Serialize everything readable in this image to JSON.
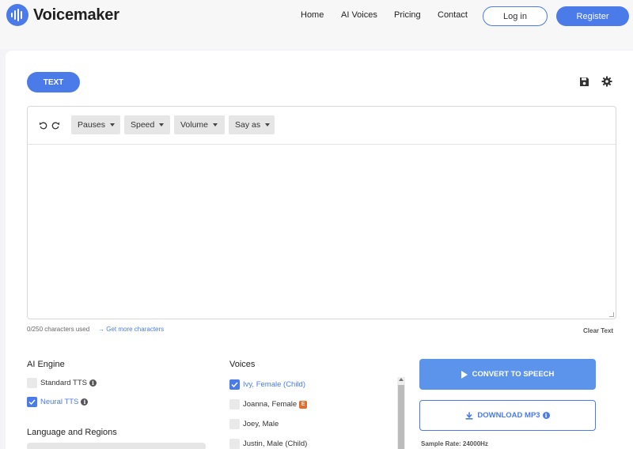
{
  "header": {
    "logo_text": "Voicemaker",
    "nav": [
      "Home",
      "AI Voices",
      "Pricing",
      "Contact"
    ],
    "login": "Log in",
    "register": "Register"
  },
  "editor": {
    "tab": "TEXT",
    "dropdowns": [
      "Pauses",
      "Speed",
      "Volume",
      "Say as"
    ],
    "char_count": "0/250 characters used",
    "more_chars": "Get more characters",
    "clear": "Clear Text"
  },
  "engine": {
    "title": "AI Engine",
    "options": [
      {
        "label": "Standard TTS",
        "checked": false
      },
      {
        "label": "Neural TTS",
        "checked": true
      }
    ]
  },
  "language": {
    "title": "Language and Regions"
  },
  "voices": {
    "title": "Voices",
    "items": [
      {
        "label": "Ivy, Female (Child)",
        "checked": true
      },
      {
        "label": "Joanna, Female",
        "checked": false,
        "badge": "E"
      },
      {
        "label": "Joey, Male",
        "checked": false
      },
      {
        "label": "Justin, Male (Child)",
        "checked": false
      }
    ]
  },
  "actions": {
    "convert": "CONVERT TO SPEECH",
    "download": "DOWNLOAD MP3",
    "sample_rate": "Sample Rate: 24000Hz"
  },
  "colors": {
    "accent": "#4a7be8",
    "convert": "#5b94ea",
    "badge": "#e86a2a"
  }
}
